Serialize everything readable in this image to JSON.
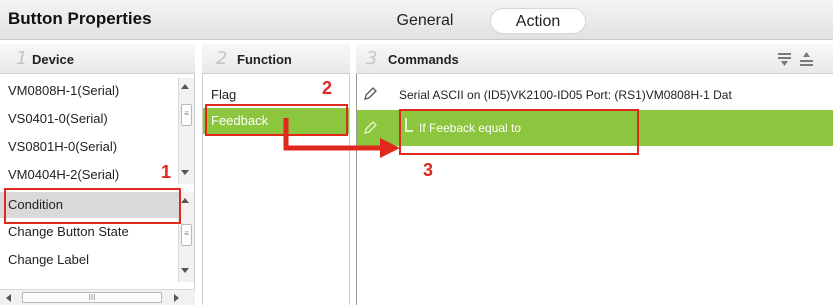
{
  "window": {
    "title": "Button Properties"
  },
  "tabs": [
    {
      "label": "General"
    },
    {
      "label": "Action"
    }
  ],
  "columns": {
    "device": {
      "number": "1",
      "label": "Device"
    },
    "function": {
      "number": "2",
      "label": "Function"
    },
    "commands": {
      "number": "3",
      "label": "Commands"
    }
  },
  "device_list": [
    {
      "label": "VM0808H-1(Serial)"
    },
    {
      "label": "VS0401-0(Serial)"
    },
    {
      "label": "VS0801H-0(Serial)"
    },
    {
      "label": "VM0404H-2(Serial)"
    },
    {
      "label": "Condition"
    },
    {
      "label": "Change Button State"
    },
    {
      "label": "Change Label"
    }
  ],
  "function_list": [
    {
      "label": "Flag"
    },
    {
      "label": "Feedback"
    }
  ],
  "commands_list": [
    {
      "text": "Serial ASCII  on (ID5)VK2100-ID05 Port: (RS1)VM0808H-1 Dat"
    },
    {
      "text": "If Feeback equal to"
    }
  ],
  "annotations": {
    "step1": "1",
    "step2": "2",
    "step3": "3"
  },
  "colors": {
    "selected_green": "#8cc63f",
    "annotation_red": "#e0281c"
  }
}
